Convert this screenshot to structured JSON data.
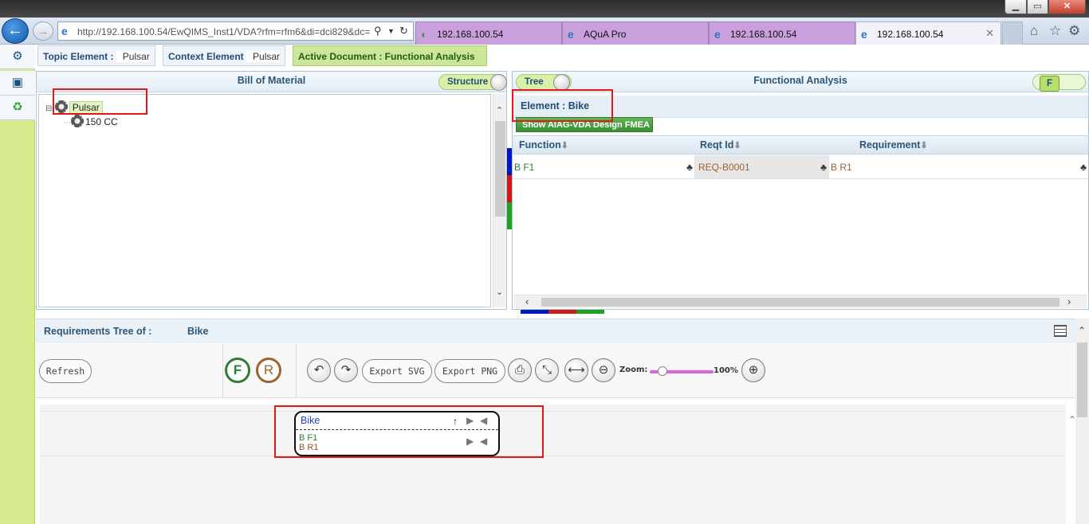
{
  "browser": {
    "address_url": "http://192.168.100.54/EwQIMS_Inst1/VDA?rfm=rfm6&di=dci829&dc=",
    "tabs": [
      {
        "label": "192.168.100.54"
      },
      {
        "label": "AQuA Pro"
      },
      {
        "label": "192.168.100.54"
      },
      {
        "label": "192.168.100.54"
      }
    ]
  },
  "header": {
    "topic_label": "Topic Element :",
    "topic_value": "Pulsar",
    "context_label": "Context Element",
    "context_value": "Pulsar",
    "active_document": "Active Document : Functional Analysis"
  },
  "bom": {
    "title": "Bill of Material",
    "toggle_label": "Structure",
    "tree": [
      {
        "label": "Pulsar",
        "expander": "⊟"
      },
      {
        "label": "150 CC"
      }
    ]
  },
  "functional_analysis": {
    "title": "Functional Analysis",
    "tree_toggle_label": "Tree",
    "f_toggle_label": "F",
    "element_label": "Element : Bike",
    "show_fmea_button": "Show AIAG-VDA Design FMEA",
    "columns": [
      "Function",
      "Reqt Id",
      "Requirement"
    ],
    "rows": [
      {
        "function": "B F1",
        "reqt_id": "REQ-B0001",
        "requirement": "B R1"
      }
    ]
  },
  "requirements_tree": {
    "label": "Requirements Tree of :",
    "element": "Bike",
    "refresh_button": "Refresh",
    "f_button": "F",
    "r_button": "R",
    "export_svg_button": "Export SVG",
    "export_png_button": "Export PNG",
    "zoom_label": "Zoom:",
    "zoom_value": "100%",
    "zoom_level": 1.0,
    "node": {
      "title": "Bike",
      "function": "B F1",
      "requirement": "B R1"
    }
  },
  "colors": {
    "accent_green": "#cbe79a",
    "rail_green": "#d6ec8e",
    "tab_purple": "#c9a0dc",
    "highlight_red": "#e01818",
    "strip": [
      "#0018c0",
      "#d01818",
      "#20a020"
    ]
  }
}
